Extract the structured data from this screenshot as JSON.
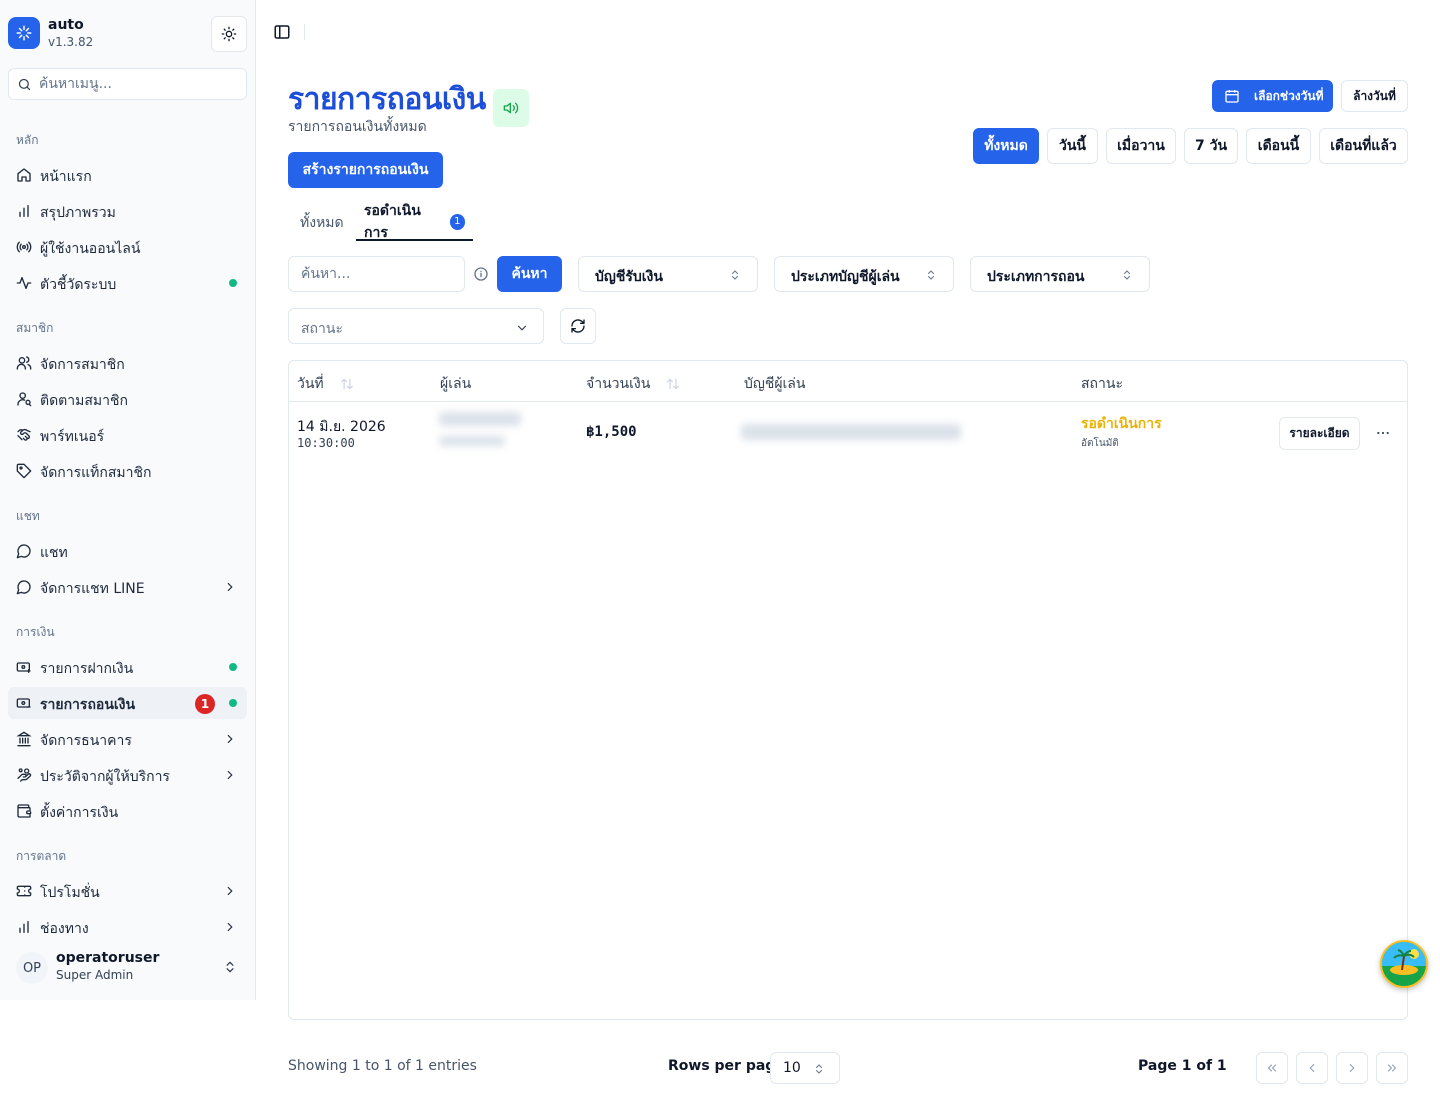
{
  "app": {
    "name": "auto",
    "version": "v1.3.82"
  },
  "sidebar": {
    "search_placeholder": "ค้นหาเมนู...",
    "groups": {
      "main": "หลัก",
      "members": "สมาชิก",
      "chat": "แชท",
      "finance": "การเงิน",
      "marketing": "การตลาด"
    },
    "items": {
      "home": "หน้าแรก",
      "overview": "สรุปภาพรวม",
      "online_users": "ผู้ใช้งานออนไลน์",
      "system_metrics": "ตัวชี้วัดระบบ",
      "manage_members": "จัดการสมาชิก",
      "track_members": "ติดตามสมาชิก",
      "partner": "พาร์ทเนอร์",
      "member_tags": "จัดการแท็กสมาชิก",
      "chat": "แชท",
      "line_chat": "จัดการแชท LINE",
      "deposits": "รายการฝากเงิน",
      "withdrawals": "รายการถอนเงิน",
      "withdrawals_badge": "1",
      "banks": "จัดการธนาคาร",
      "provider_history": "ประวัติจากผู้ให้บริการ",
      "finance_settings": "ตั้งค่าการเงิน",
      "promotions": "โปรโมชั่น",
      "channels": "ช่องทาง"
    },
    "user": {
      "initials": "OP",
      "name": "operatoruser",
      "role": "Super Admin"
    }
  },
  "page": {
    "title": "รายการถอนเงิน",
    "subtitle": "รายการถอนเงินทั้งหมด",
    "create_button": "สร้างรายการถอนเงิน",
    "date_range_button": "เลือกช่วงวันที่",
    "clear_date_button": "ล้างวันที่",
    "ranges": [
      "ทั้งหมด",
      "วันนี้",
      "เมื่อวาน",
      "7 วัน",
      "เดือนนี้",
      "เดือนที่แล้ว"
    ],
    "active_range": "ทั้งหมด"
  },
  "tabs": {
    "all": "ทั้งหมด",
    "pending": "รอดำเนินการ",
    "pending_count": "1"
  },
  "filters": {
    "search_placeholder": "ค้นหา...",
    "search_button": "ค้นหา",
    "receiving_account": "บัญชีรับเงิน",
    "player_account_type": "ประเภทบัญชีผู้เล่น",
    "withdraw_type": "ประเภทการถอน",
    "status_placeholder": "สถานะ"
  },
  "table": {
    "columns": {
      "date": "วันที่",
      "player": "ผู้เล่น",
      "amount": "จำนวนเงิน",
      "player_account": "บัญชีผู้เล่น",
      "status": "สถานะ"
    },
    "rows": [
      {
        "date": "14 มิ.ย. 2026",
        "time": "10:30:00",
        "amount": "฿1,500",
        "status": "รอดำเนินการ",
        "status_sub": "อัตโนมัติ",
        "detail_button": "รายละเอียด"
      }
    ]
  },
  "footer": {
    "showing": "Showing 1 to 1 of 1 entries",
    "rows_per_page_label": "Rows per page",
    "rows_per_page": "10",
    "page_info": "Page 1 of 1"
  },
  "colors": {
    "primary": "#2563eb",
    "title": "#1d4ed8",
    "pending": "#eab308",
    "online_dot": "#10b981",
    "badge": "#dc2626"
  }
}
